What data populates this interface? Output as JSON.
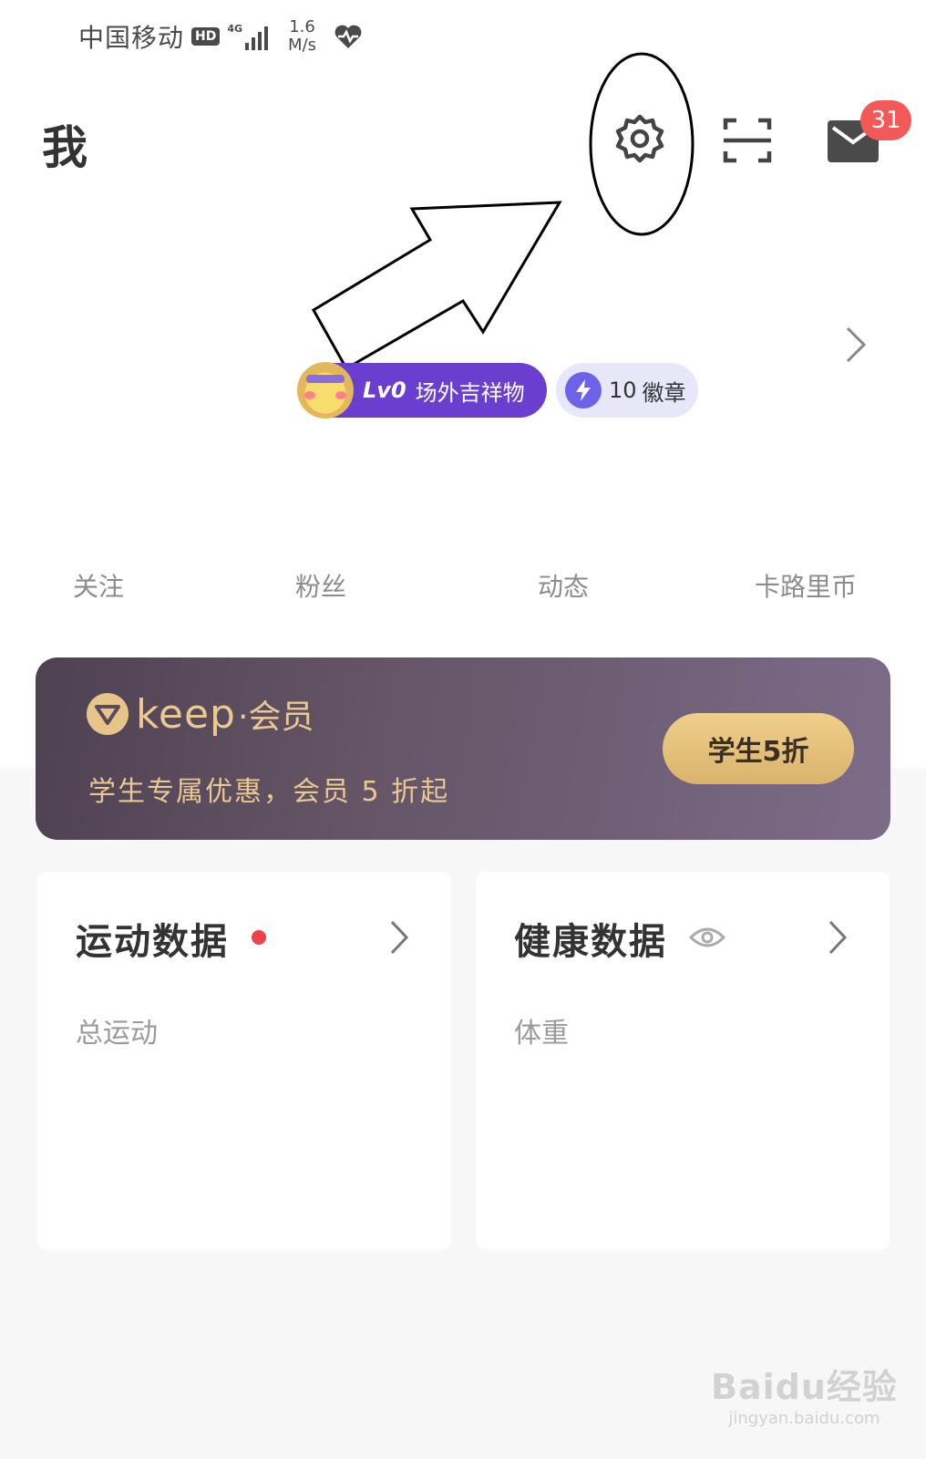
{
  "status_bar": {
    "carrier": "中国移动",
    "hd": "HD",
    "network": "4G",
    "speed_value": "1.6",
    "speed_unit": "M/s"
  },
  "header": {
    "title": "我",
    "mail_badge_count": "31"
  },
  "profile": {
    "level": "Lv0",
    "level_name": "场外吉祥物",
    "badge_count": "10",
    "badge_label": "徽章"
  },
  "stats": [
    "关注",
    "粉丝",
    "动态",
    "卡路里币"
  ],
  "member": {
    "brand": "keep",
    "brand_suffix": "·会员",
    "promo": "学生专属优惠，会员 5 折起",
    "button_label": "学生5折"
  },
  "cards": {
    "sports": {
      "title": "运动数据",
      "subtitle": "总运动"
    },
    "health": {
      "title": "健康数据",
      "subtitle": "体重"
    }
  },
  "watermark": {
    "main": "Baidu经验",
    "sub": "jingyan.baidu.com"
  },
  "colors": {
    "accent_purple": "#6a3fd0",
    "badge_red": "#f25a5a",
    "member_gold": "#e9c891"
  }
}
